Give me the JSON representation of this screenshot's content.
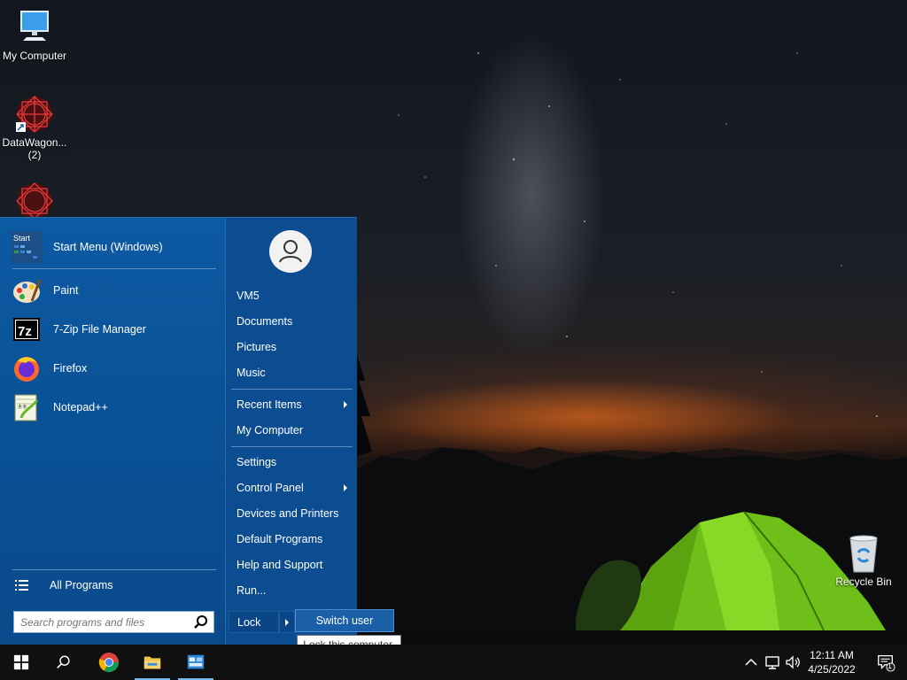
{
  "desktop": {
    "icons": [
      {
        "label": "My Computer",
        "icon": "monitor-icon"
      },
      {
        "label": "DataWagon... (2)",
        "icon": "datawagon-icon"
      },
      {
        "label": "",
        "icon": "datawagon-icon"
      },
      {
        "label": "Recycle Bin",
        "icon": "recycle-bin-icon"
      }
    ]
  },
  "start_menu": {
    "pinned": [
      {
        "label": "Start Menu (Windows)",
        "icon": "start-menu-icon"
      },
      {
        "label": "Paint",
        "icon": "paint-icon"
      },
      {
        "label": "7-Zip File Manager",
        "icon": "7zip-icon"
      },
      {
        "label": "Firefox",
        "icon": "firefox-icon"
      },
      {
        "label": "Notepad++",
        "icon": "notepadpp-icon"
      }
    ],
    "all_programs": "All Programs",
    "search_placeholder": "Search programs and files",
    "right_items": {
      "user": "VM5",
      "documents": "Documents",
      "pictures": "Pictures",
      "music": "Music",
      "recent_items": "Recent Items",
      "my_computer": "My Computer",
      "settings": "Settings",
      "control_panel": "Control Panel",
      "devices_printers": "Devices and Printers",
      "default_programs": "Default Programs",
      "help_support": "Help and Support",
      "run": "Run..."
    },
    "lock": "Lock",
    "switch_user": "Switch user",
    "tooltip": "Lock this computer."
  },
  "taskbar": {
    "time": "12:11 AM",
    "date": "4/25/2022",
    "notification_count": "1"
  },
  "colors": {
    "menu_blue": "#0a4f93",
    "highlight": "#1a5fa8",
    "taskbar": "#101010"
  }
}
